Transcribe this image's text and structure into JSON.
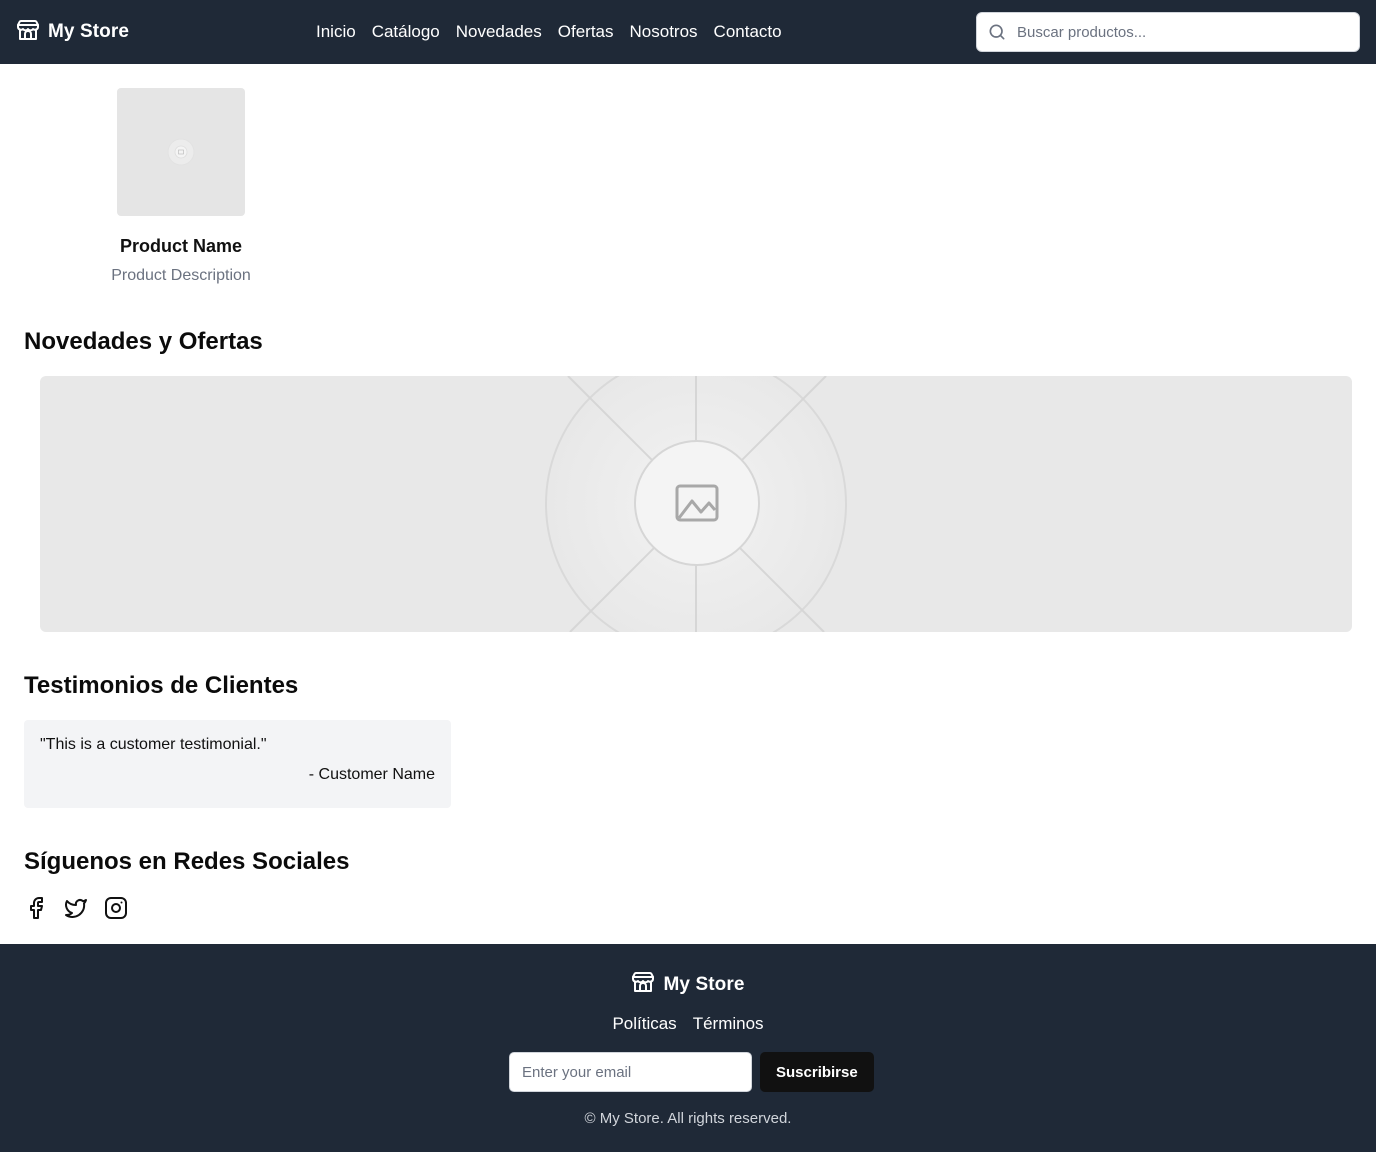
{
  "header": {
    "brand": "My Store",
    "nav": [
      "Inicio",
      "Catálogo",
      "Novedades",
      "Ofertas",
      "Nosotros",
      "Contacto"
    ],
    "search_placeholder": "Buscar productos..."
  },
  "product": {
    "name": "Product Name",
    "description": "Product Description"
  },
  "sections": {
    "news_title": "Novedades y Ofertas",
    "testimonials_title": "Testimonios de Clientes",
    "social_title": "Síguenos en Redes Sociales"
  },
  "testimonial": {
    "quote": "\"This is a customer testimonial.\"",
    "author": "- Customer Name"
  },
  "social": {
    "icons": [
      "facebook-icon",
      "twitter-icon",
      "instagram-icon"
    ]
  },
  "footer": {
    "brand": "My Store",
    "links": [
      "Políticas",
      "Términos"
    ],
    "email_placeholder": "Enter your email",
    "subscribe_label": "Suscribirse",
    "copyright": "© My Store. All rights reserved."
  },
  "colors": {
    "header_bg": "#1f2937",
    "footer_bg": "#1f2937",
    "placeholder_bg": "#e8e8e8",
    "testimonial_bg": "#f3f4f6"
  }
}
